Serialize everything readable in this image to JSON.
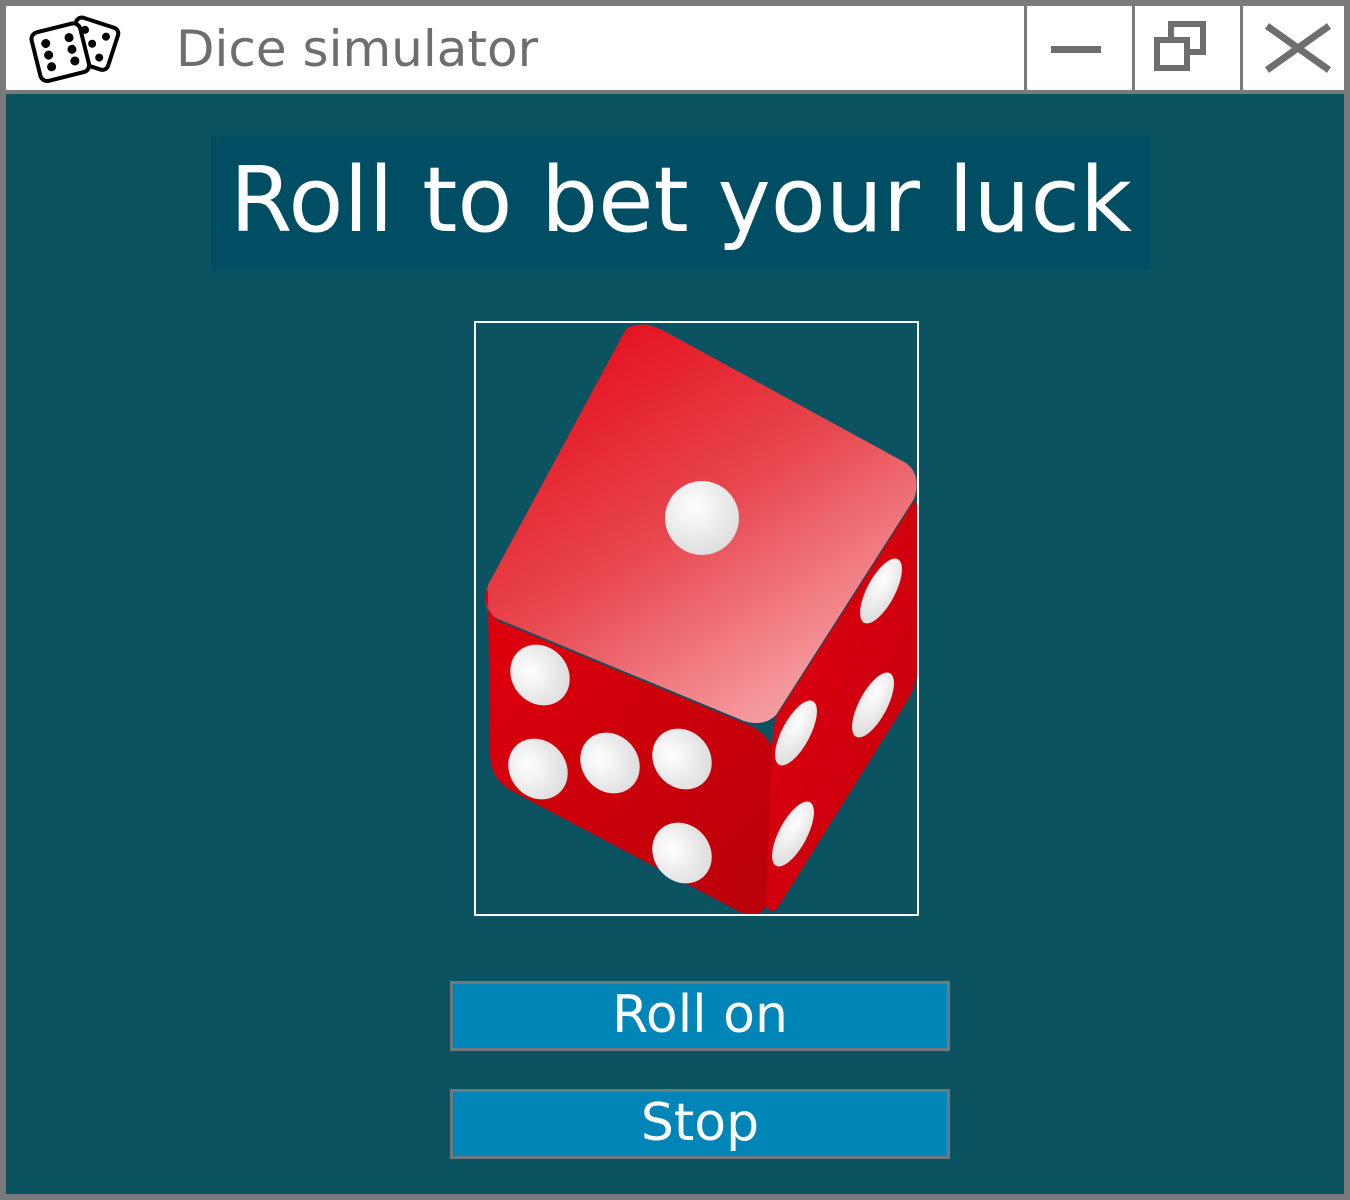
{
  "window": {
    "title": "Dice simulator",
    "app_icon": "dice-pair-icon",
    "controls": {
      "minimize_icon": "minimize-icon",
      "restore_icon": "restore-icon",
      "close_icon": "close-icon"
    }
  },
  "main": {
    "headline": "Roll to bet your luck",
    "dice": {
      "icon": "red-die-image",
      "top_face_pips": 1,
      "left_face_pips": 5,
      "right_face_pips": 4
    },
    "buttons": {
      "roll_label": "Roll on",
      "stop_label": "Stop"
    }
  },
  "colors": {
    "background": "#0b5361",
    "headline_bg": "#004e64",
    "button_bg": "#0085b9",
    "die_red": "#d9000d"
  }
}
